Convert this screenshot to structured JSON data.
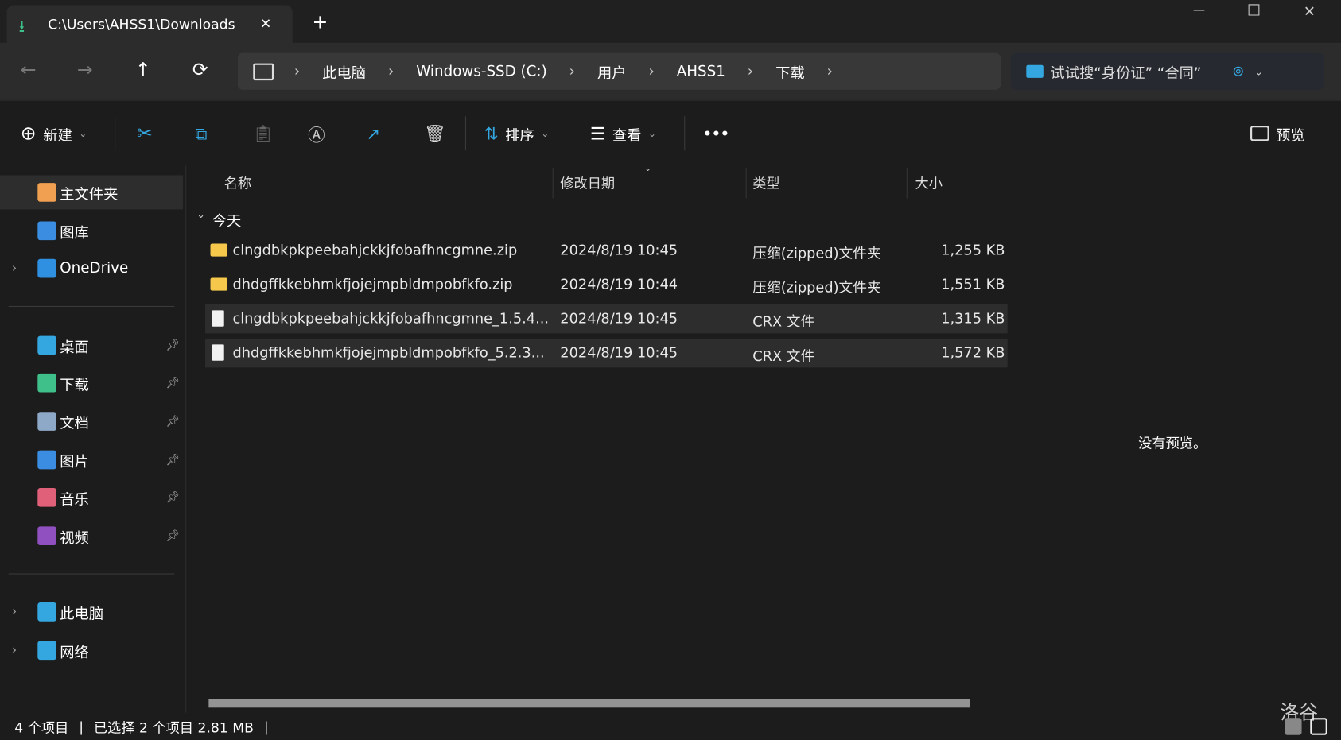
{
  "window": {
    "tab_title": "C:\\Users\\AHSS1\\Downloads",
    "new_tab": "+",
    "minimize": "—",
    "maximize": "☐",
    "close": "✕"
  },
  "nav": {
    "back": "←",
    "forward": "→",
    "up": "↑",
    "refresh": "⟳"
  },
  "breadcrumb": [
    "此电脑",
    "Windows-SSD (C:)",
    "用户",
    "AHSS1",
    "下载"
  ],
  "search": {
    "placeholder": "试试搜“身份证” “合同”"
  },
  "toolbar": {
    "new": "新建",
    "sort": "排序",
    "view": "查看",
    "more": "•••",
    "preview": "预览"
  },
  "sidebar": {
    "items": [
      {
        "label": "主文件夹",
        "icon": "home-icon",
        "color": "#f0a050"
      },
      {
        "label": "图库",
        "icon": "gallery-icon",
        "color": "#3a8de0"
      },
      {
        "label": "OneDrive",
        "icon": "onedrive-icon",
        "color": "#2f8fe0"
      },
      {
        "label": "桌面",
        "icon": "desktop-icon",
        "color": "#35a7e0"
      },
      {
        "label": "下载",
        "icon": "download-icon",
        "color": "#3fbf8a"
      },
      {
        "label": "文档",
        "icon": "documents-icon",
        "color": "#8ea8c8"
      },
      {
        "label": "图片",
        "icon": "pictures-icon",
        "color": "#3a8de0"
      },
      {
        "label": "音乐",
        "icon": "music-icon",
        "color": "#e0607a"
      },
      {
        "label": "视频",
        "icon": "videos-icon",
        "color": "#9050c0"
      },
      {
        "label": "此电脑",
        "icon": "this-pc-icon",
        "color": "#35a7e0"
      },
      {
        "label": "网络",
        "icon": "network-icon",
        "color": "#35a7e0"
      }
    ]
  },
  "columns": [
    "名称",
    "修改日期",
    "类型",
    "大小"
  ],
  "group": "今天",
  "files": [
    {
      "name": "clngdbkpkpeebahjckkjfobafhncgmne.zip",
      "date": "2024/8/19 10:45",
      "type": "压缩(zipped)文件夹",
      "size": "1,255 KB",
      "icon": "zip-folder-icon",
      "selected": false
    },
    {
      "name": "dhdgffkkebhmkfjojejmpbldmpobfkfo.zip",
      "date": "2024/8/19 10:44",
      "type": "压缩(zipped)文件夹",
      "size": "1,551 KB",
      "icon": "zip-folder-icon",
      "selected": false
    },
    {
      "name": "clngdbkpkpeebahjckkjfobafhncgmne_1.5.4...",
      "date": "2024/8/19 10:45",
      "type": "CRX 文件",
      "size": "1,315 KB",
      "icon": "file-icon",
      "selected": true
    },
    {
      "name": "dhdgffkkebhmkfjojejmpbldmpobfkfo_5.2.3...",
      "date": "2024/8/19 10:45",
      "type": "CRX 文件",
      "size": "1,572 KB",
      "icon": "file-icon",
      "selected": true
    }
  ],
  "preview_pane": {
    "message": "没有预览。"
  },
  "status": {
    "count": "4 个项目",
    "selected": "已选择 2 个项目  2.81 MB"
  },
  "watermark": "洛谷"
}
